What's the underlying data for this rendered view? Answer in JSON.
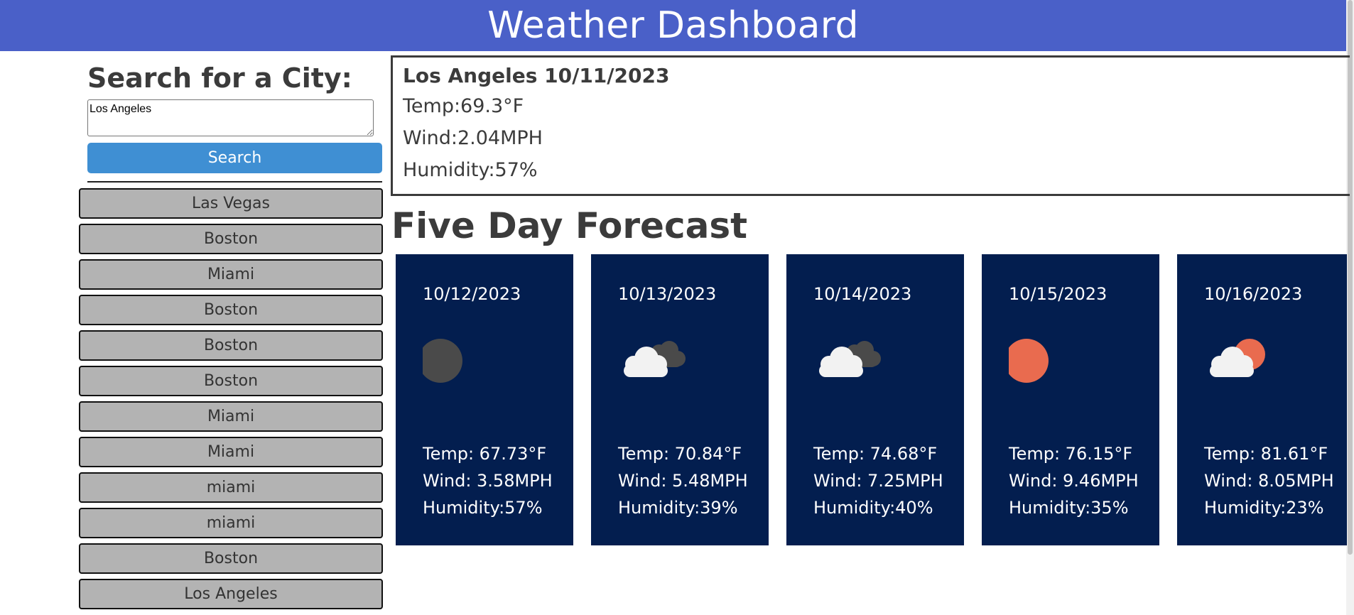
{
  "header": {
    "title": "Weather Dashboard"
  },
  "sidebar": {
    "heading": "Search for a City:",
    "input_value": "Los Angeles",
    "search_label": "Search",
    "history": [
      "Las Vegas",
      "Boston",
      "Miami",
      "Boston",
      "Boston",
      "Boston",
      "Miami",
      "Miami",
      "miami",
      "miami",
      "Boston",
      "Los Angeles"
    ]
  },
  "current": {
    "city_date": "Los Angeles 10/11/2023",
    "temp": "Temp:69.3°F",
    "wind": "Wind:2.04MPH",
    "humidity": "Humidity:57%"
  },
  "forecast": {
    "heading": "Five Day Forecast",
    "days": [
      {
        "date": "10/12/2023",
        "icon": "dark-moon-icon",
        "temp": "Temp: 67.73°F",
        "wind": "Wind: 3.58MPH",
        "humidity": "Humidity:57%"
      },
      {
        "date": "10/13/2023",
        "icon": "broken-clouds-icon",
        "temp": "Temp: 70.84°F",
        "wind": "Wind: 5.48MPH",
        "humidity": "Humidity:39%"
      },
      {
        "date": "10/14/2023",
        "icon": "broken-clouds-icon",
        "temp": "Temp: 74.68°F",
        "wind": "Wind: 7.25MPH",
        "humidity": "Humidity:40%"
      },
      {
        "date": "10/15/2023",
        "icon": "clear-sun-icon",
        "temp": "Temp: 76.15°F",
        "wind": "Wind: 9.46MPH",
        "humidity": "Humidity:35%"
      },
      {
        "date": "10/16/2023",
        "icon": "few-clouds-icon",
        "temp": "Temp: 81.61°F",
        "wind": "Wind: 8.05MPH",
        "humidity": "Humidity:23%"
      }
    ]
  },
  "colors": {
    "header_bg": "#4a60c8",
    "search_button": "#3f8fd3",
    "history_button": "#b3b3b3",
    "card_bg": "#031e4f",
    "sun": "#e96b4f",
    "moon": "#4a4a4a",
    "cloud": "#f2f2f2",
    "dark_cloud": "#4a4a4a"
  }
}
